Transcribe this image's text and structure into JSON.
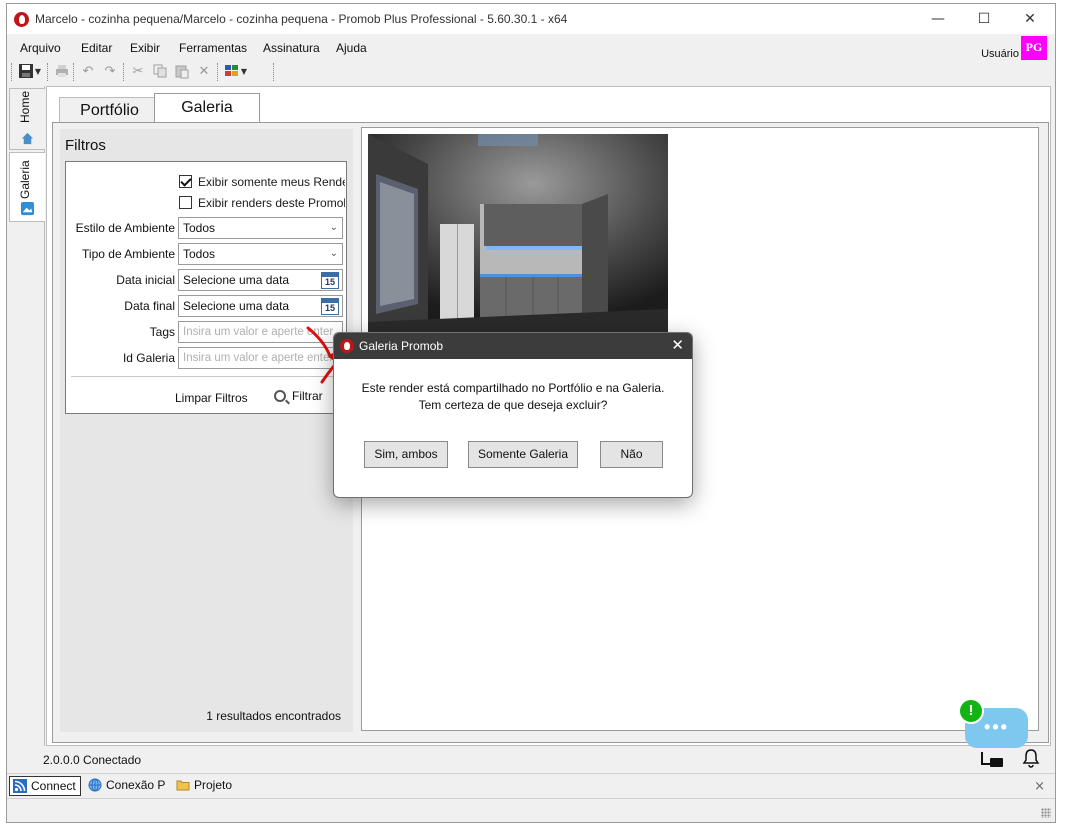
{
  "window": {
    "title": "Marcelo - cozinha pequena/Marcelo - cozinha pequena - Promob Plus Professional - 5.60.30.1 - x64",
    "minimize_glyph": "—",
    "maximize_glyph": "☐",
    "close_glyph": "✕"
  },
  "menu": {
    "items": [
      "Arquivo",
      "Editar",
      "Exibir",
      "Ferramentas",
      "Assinatura",
      "Ajuda"
    ]
  },
  "user": {
    "label": "Usuário",
    "badge": "PG",
    "badge_color": "#ff00ff"
  },
  "toolbar": {
    "icons": [
      "save-icon",
      "dropdown-icon",
      "print-icon",
      "undo-icon",
      "redo-icon",
      "cut-icon",
      "copy-icon",
      "paste-icon",
      "delete-icon",
      "color-palette-icon"
    ]
  },
  "side_tabs": [
    {
      "label": "Home",
      "icon": "home-icon",
      "active": false
    },
    {
      "label": "Galeria",
      "icon": "gallery-icon",
      "active": true
    }
  ],
  "tabs": [
    {
      "label": "Portfólio",
      "active": false
    },
    {
      "label": "Galeria",
      "active": true
    }
  ],
  "filters": {
    "title": "Filtros",
    "checkboxes": [
      {
        "label": "Exibir somente meus Renders",
        "checked": true
      },
      {
        "label": "Exibir renders deste Promob",
        "checked": false
      }
    ],
    "estilo_label": "Estilo de Ambiente",
    "estilo_value": "Todos",
    "tipo_label": "Tipo de Ambiente",
    "tipo_value": "Todos",
    "data_inicial_label": "Data inicial",
    "data_inicial_value": "Selecione uma data",
    "data_final_label": "Data final",
    "data_final_value": "Selecione uma data",
    "calendar_day": "15",
    "tags_label": "Tags",
    "tags_placeholder": "Insira um valor e aperte enter",
    "id_label": "Id Galeria",
    "id_placeholder": "Insira um valor e aperte enter",
    "clear_label": "Limpar Filtros",
    "filter_label": "Filtrar",
    "results": "1 resultados encontrados"
  },
  "status": {
    "text": "2.0.0.0  Conectado"
  },
  "taskbar": {
    "items": [
      {
        "label": "Connect",
        "icon": "rss-icon",
        "active": true
      },
      {
        "label": "Conexão P",
        "icon": "globe-icon",
        "active": false
      },
      {
        "label": "Projeto",
        "icon": "folder-icon",
        "active": false
      }
    ],
    "close_glyph": "×"
  },
  "chat": {
    "dots": "•••",
    "alert": "!",
    "color": "#7ec8f0",
    "alert_color": "#12b312"
  },
  "dialog": {
    "title": "Galeria Promob",
    "close_glyph": "✕",
    "message_line1": "Este render está compartilhado no Portfólio e na Galeria.",
    "message_line2": "Tem certeza de que deseja excluir?",
    "buttons": [
      "Sim, ambos",
      "Somente Galeria",
      "Não"
    ]
  },
  "colors": {
    "promob_red": "#c0141b",
    "dialog_title_bg": "#3c3c3c",
    "annotation_arrow": "#e01010"
  }
}
